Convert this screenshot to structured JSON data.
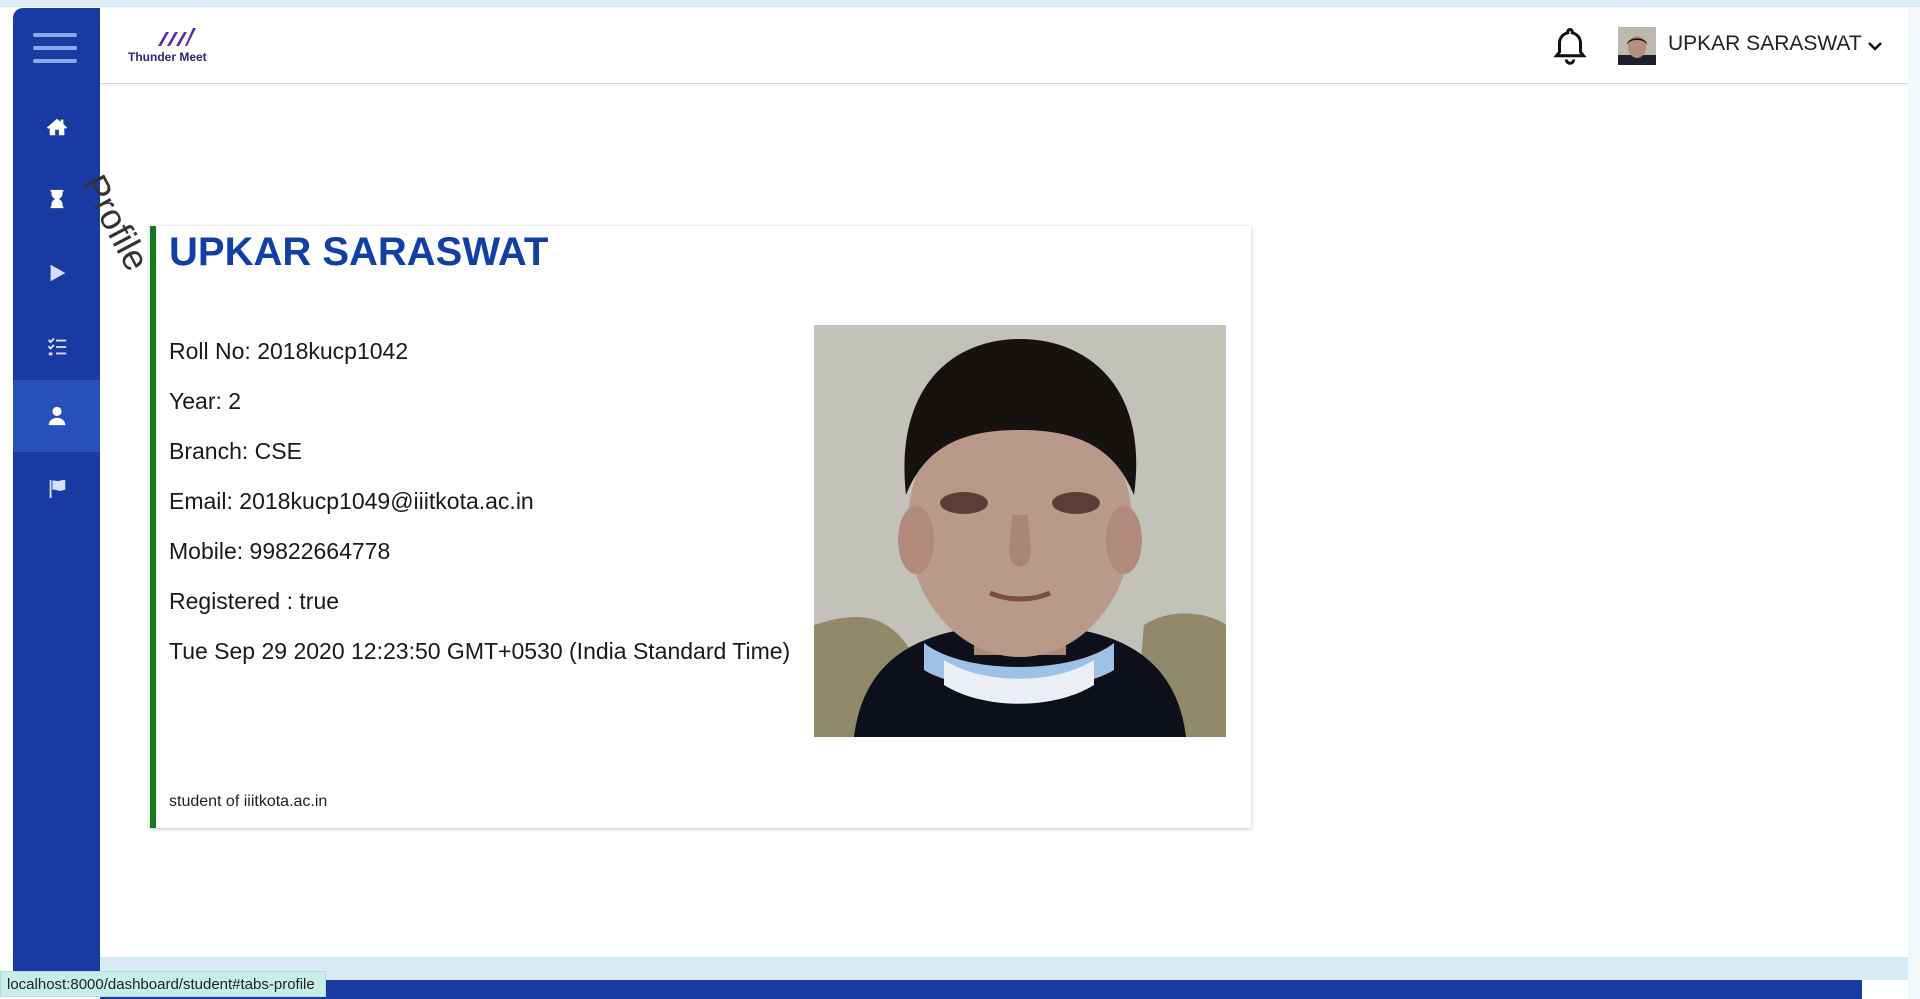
{
  "app": {
    "name": "Thunder Meet",
    "accent": "#1a3aa3",
    "status_url": "localhost:8000/dashboard/student#tabs-profile"
  },
  "header": {
    "user_name": "UPKAR SARASWAT"
  },
  "sidebar": {
    "items": [
      {
        "icon": "home-icon",
        "active": false
      },
      {
        "icon": "hourglass-icon",
        "active": false
      },
      {
        "icon": "play-icon",
        "active": false
      },
      {
        "icon": "list-check-icon",
        "active": false
      },
      {
        "icon": "user-icon",
        "active": true
      },
      {
        "icon": "flag-icon",
        "active": false
      }
    ]
  },
  "main": {
    "tab_label": "Profile",
    "profile": {
      "name": "UPKAR SARASWAT",
      "roll_no": "Roll No: 2018kucp1042",
      "year": "Year: 2",
      "branch": "Branch: CSE",
      "email": "Email: 2018kucp1049@iiitkota.ac.in",
      "mobile": "Mobile: 99822664778",
      "registered": "Registered : true",
      "date": "Tue Sep 29 2020 12:23:50 GMT+0530 (India Standard Time)",
      "footer": "student of iiitkota.ac.in",
      "card_border_color": "#137a21",
      "name_color": "#123fa6"
    }
  }
}
